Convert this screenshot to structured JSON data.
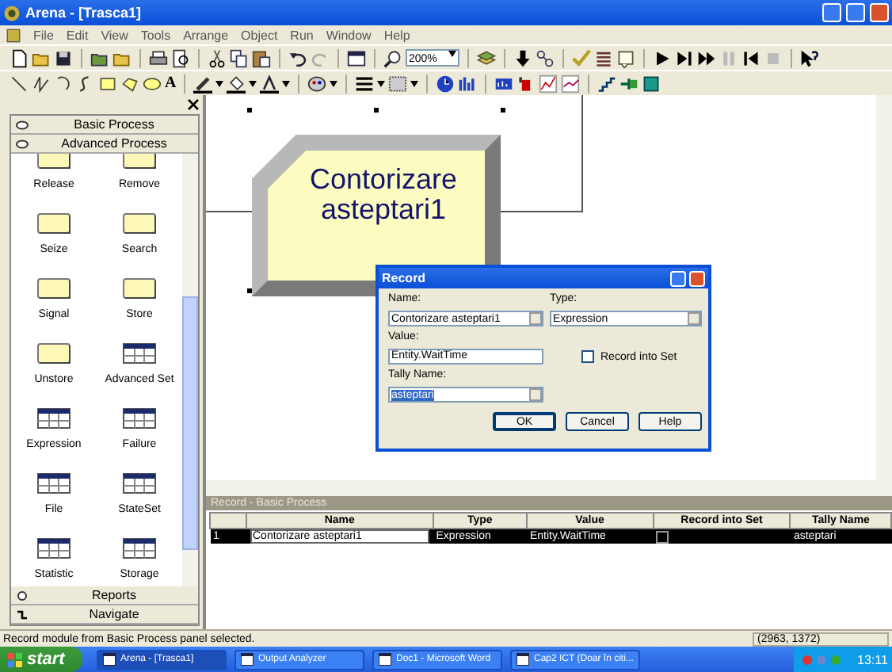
{
  "window": {
    "title": "Arena - [Trasca1]"
  },
  "menu": [
    "File",
    "Edit",
    "View",
    "Tools",
    "Arrange",
    "Object",
    "Run",
    "Window",
    "Help"
  ],
  "toolbar": {
    "zoom": "200%",
    "text_tool": "A"
  },
  "project_bar": {
    "panels_top": [
      {
        "label": "Basic Process"
      },
      {
        "label": "Advanced Process"
      }
    ],
    "modules": [
      {
        "label": "Release",
        "kind": "flowchart"
      },
      {
        "label": "Remove",
        "kind": "flowchart"
      },
      {
        "label": "Seize",
        "kind": "flowchart"
      },
      {
        "label": "Search",
        "kind": "flowchart"
      },
      {
        "label": "Signal",
        "kind": "flowchart"
      },
      {
        "label": "Store",
        "kind": "flowchart"
      },
      {
        "label": "Unstore",
        "kind": "flowchart"
      },
      {
        "label": "Advanced Set",
        "kind": "data"
      },
      {
        "label": "Expression",
        "kind": "data"
      },
      {
        "label": "Failure",
        "kind": "data"
      },
      {
        "label": "File",
        "kind": "data"
      },
      {
        "label": "StateSet",
        "kind": "data"
      },
      {
        "label": "Statistic",
        "kind": "data"
      },
      {
        "label": "Storage",
        "kind": "data"
      }
    ],
    "panels_bottom": [
      {
        "label": "Reports"
      },
      {
        "label": "Navigate"
      }
    ]
  },
  "canvas": {
    "module_label": "Contorizare asteptari1"
  },
  "dialog": {
    "title": "Record",
    "name_label": "Name:",
    "name_value": "Contorizare asteptari1",
    "type_label": "Type:",
    "type_value": "Expression",
    "value_label": "Value:",
    "value_value": "Entity.WaitTime",
    "record_into_set": {
      "label": "Record into Set",
      "checked": false
    },
    "tally_label": "Tally Name:",
    "tally_value": "asteptari",
    "tally_text_selected": true,
    "buttons": [
      "OK",
      "Cancel",
      "Help"
    ]
  },
  "spreadsheet": {
    "title": "Record - Basic Process",
    "columns": [
      "Name",
      "Type",
      "Value",
      "Record into Set",
      "Tally Name"
    ],
    "rows": [
      {
        "number": "1",
        "name": "Contorizare asteptari1",
        "type": "Expression",
        "value": "Entity.WaitTime",
        "record_into_set": false,
        "tally_name": "asteptari",
        "selected": true
      }
    ]
  },
  "status_bar": {
    "message": "Record module from Basic Process panel selected.",
    "coordinates": "(2963, 1372)"
  },
  "taskbar": {
    "start": "start",
    "tasks": [
      {
        "label": "Arena - [Trasca1]",
        "selected": true
      },
      {
        "label": "Output Analyzer",
        "selected": false
      },
      {
        "label": "Doc1 - Microsoft Word",
        "selected": false
      },
      {
        "label": "Cap2 ICT (Doar în citi...",
        "selected": false
      }
    ],
    "clock": "13:11"
  }
}
